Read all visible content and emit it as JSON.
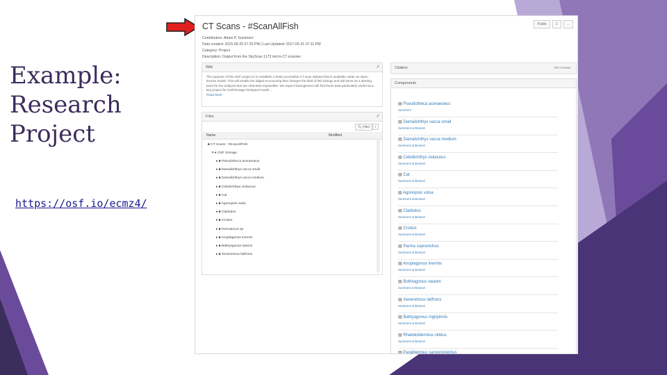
{
  "slide": {
    "title_lines": [
      "Example:",
      "Research",
      "Project"
    ],
    "link": "https://osf.io/ecmz4/",
    "colors": {
      "purple_dark": "#3b2d5c",
      "purple_mid": "#6a4a9a",
      "purple_light": "#b9a9d6",
      "arrow": "#e02020"
    }
  },
  "screenshot": {
    "project_title": "CT Scans - #ScanAllFish",
    "buttons": [
      "Public",
      "1",
      "..."
    ],
    "meta": {
      "contributors": "Contributors: Adam P. Summers",
      "dates": "Date created: 2015-05-25 07:20 PM | Last Updated: 2017-05-31 07:11 PM",
      "category": "Category: Project",
      "description": "Description: Output from the SkyScan 1173 micro-CT scanner"
    },
    "wiki": {
      "heading": "Wiki",
      "body": "The purpose of this OSF project is to establish a freely accessible CT scan dataset that is available under an Open license model. This will enable the digital re-scanning that changes the field of fish biology and will serve as a starting point for the analysis that are otherwise impossible. We expect bioengineers will find these data particularly useful as a key project for multi-lineage biological model...",
      "read_more": "Read More"
    },
    "files": {
      "heading": "Files",
      "filter_label": "Filter",
      "columns": {
        "name": "Name",
        "modified": "Modified"
      },
      "root": "CT Scans - #ScanAllFish",
      "storage": "OSF Storage",
      "folders": [
        "Pseudotheca aceraeoeus",
        "Damalichthys vacca small",
        "Damalichthys vacca medium",
        "Cebidichthys violaceus",
        "Cat",
        "Agonopsis vulsa",
        "Cladodus",
        "Crodus",
        "Parmaturus sp",
        "Anoplagonus inermis",
        "Bathyagonus swanni",
        "Xeneretmus latifrons"
      ]
    },
    "citation": {
      "heading": "Citation",
      "style": "APA Format"
    },
    "components": {
      "heading": "Components",
      "items": [
        {
          "name": "Pseudotheca aceraeoeus",
          "sub": "Summers"
        },
        {
          "name": "Damalichthys vacca small",
          "sub": "Summers & Breanzi"
        },
        {
          "name": "Damalichthys vacca medium",
          "sub": "Summers & Breanzi"
        },
        {
          "name": "Cebidichthys violaceus",
          "sub": "Summers & Breanzi"
        },
        {
          "name": "Cat",
          "sub": "Summers & Breanzi"
        },
        {
          "name": "Agonopsis vulsa",
          "sub": "Summers & Breanzi"
        },
        {
          "name": "Cladodus",
          "sub": "Summers & Breanzi"
        },
        {
          "name": "Crodus",
          "sub": "Summers & Breanzi"
        },
        {
          "name": "Parma saynenchus",
          "sub": "Summers & Breanzi"
        },
        {
          "name": "Anoplagonus inermis",
          "sub": "Summers & Breanzi"
        },
        {
          "name": "Bothragonus swanni",
          "sub": "Summers & Breanzi"
        },
        {
          "name": "Xeneretmus latifrons",
          "sub": "Summers & Breanzi"
        },
        {
          "name": "Bathyagonus nigripinnis",
          "sub": "Summers & Breanzi"
        },
        {
          "name": "Rhabdoblennius nitidus",
          "sub": "Summers & Breanzi"
        },
        {
          "name": "Parablennius sanguinolentus",
          "sub": ""
        }
      ]
    }
  }
}
